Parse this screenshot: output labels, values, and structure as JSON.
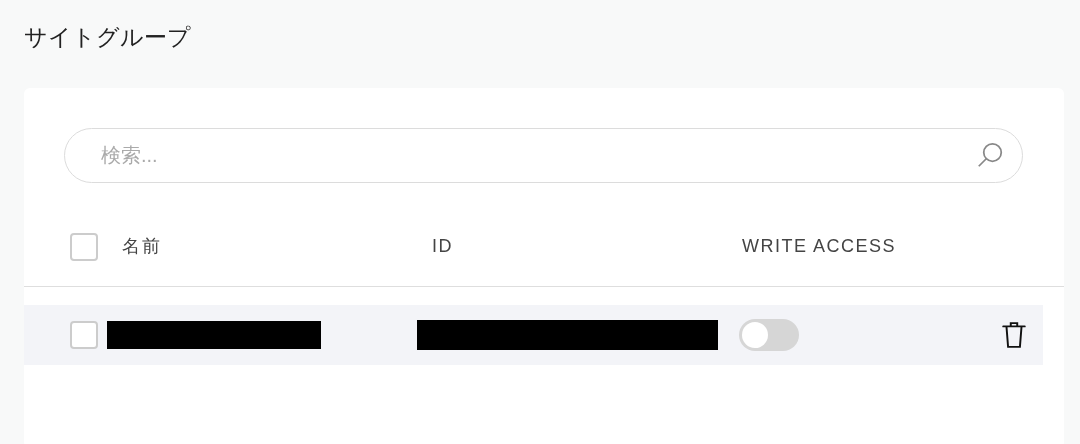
{
  "page": {
    "title": "サイトグループ"
  },
  "search": {
    "placeholder": "検索..."
  },
  "table": {
    "select_all": {
      "checked": false
    },
    "columns": [
      "名前",
      "ID",
      "WRITE ACCESS"
    ],
    "rows": [
      {
        "checked": false,
        "write_access": {
          "on": false
        }
      }
    ]
  }
}
